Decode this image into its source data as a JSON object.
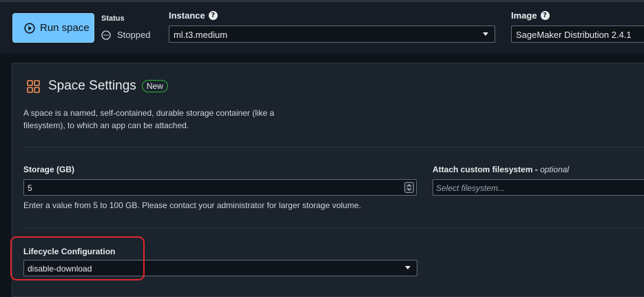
{
  "topbar": {
    "run_label": "Run space",
    "status_label": "Status",
    "status_value": "Stopped",
    "instance_label": "Instance",
    "instance_value": "ml.t3.medium",
    "image_label": "Image",
    "image_value": "SageMaker Distribution 2.4.1"
  },
  "panel": {
    "title": "Space Settings",
    "badge": "New",
    "description": "A space is a named, self-contained, durable storage container (like a filesystem), to which an app can be attached.",
    "storage": {
      "label": "Storage (GB)",
      "value": "5",
      "hint": "Enter a value from 5 to 100 GB. Please contact your administrator for larger storage volume."
    },
    "filesystem": {
      "label": "Attach custom filesystem -",
      "optional": "optional",
      "placeholder": "Select filesystem..."
    },
    "lifecycle": {
      "label": "Lifecycle Configuration",
      "value": "disable-download"
    }
  },
  "colors": {
    "accent": "#6fc3ff",
    "badge_border": "#2bb534",
    "highlight": "#e0262e",
    "icon_orange": "#f89256"
  }
}
